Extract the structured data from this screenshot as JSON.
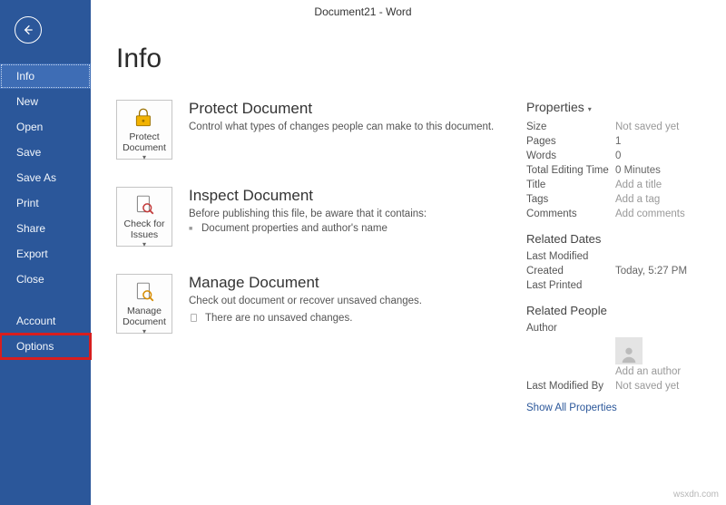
{
  "app_title": "Document21  -  Word",
  "sidebar": {
    "items": [
      {
        "id": "info",
        "label": "Info",
        "active": true
      },
      {
        "id": "new",
        "label": "New"
      },
      {
        "id": "open",
        "label": "Open"
      },
      {
        "id": "save",
        "label": "Save"
      },
      {
        "id": "saveas",
        "label": "Save As"
      },
      {
        "id": "print",
        "label": "Print"
      },
      {
        "id": "share",
        "label": "Share"
      },
      {
        "id": "export",
        "label": "Export"
      },
      {
        "id": "close",
        "label": "Close"
      },
      {
        "id": "account",
        "label": "Account"
      },
      {
        "id": "options",
        "label": "Options",
        "highlight": true
      }
    ]
  },
  "page": {
    "title": "Info"
  },
  "sections": {
    "protect": {
      "button": "Protect Document",
      "title": "Protect Document",
      "desc": "Control what types of changes people can make to this document."
    },
    "inspect": {
      "button": "Check for Issues",
      "title": "Inspect Document",
      "desc": "Before publishing this file, be aware that it contains:",
      "items": [
        "Document properties and author's name"
      ]
    },
    "manage": {
      "button": "Manage Document",
      "title": "Manage Document",
      "desc": "Check out document or recover unsaved changes.",
      "no_changes": "There are no unsaved changes."
    }
  },
  "properties": {
    "header": "Properties",
    "rows": [
      {
        "k": "Size",
        "v": "Not saved yet",
        "muted": true
      },
      {
        "k": "Pages",
        "v": "1"
      },
      {
        "k": "Words",
        "v": "0"
      },
      {
        "k": "Total Editing Time",
        "v": "0 Minutes"
      },
      {
        "k": "Title",
        "v": "Add a title",
        "muted": true
      },
      {
        "k": "Tags",
        "v": "Add a tag",
        "muted": true
      },
      {
        "k": "Comments",
        "v": "Add comments",
        "muted": true
      }
    ],
    "dates": {
      "header": "Related Dates",
      "rows": [
        {
          "k": "Last Modified",
          "v": ""
        },
        {
          "k": "Created",
          "v": "Today, 5:27 PM"
        },
        {
          "k": "Last Printed",
          "v": ""
        }
      ]
    },
    "people": {
      "header": "Related People",
      "author_label": "Author",
      "add_author": "Add an author",
      "last_modified_by_label": "Last Modified By",
      "last_modified_by_value": "Not saved yet"
    },
    "show_all": "Show All Properties"
  },
  "watermark": "wsxdn.com"
}
